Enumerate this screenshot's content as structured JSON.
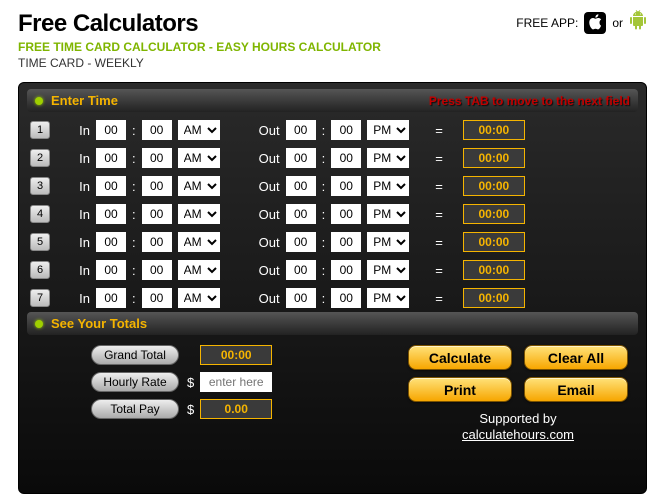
{
  "header": {
    "logo": "Free Calculators",
    "subtitle": "FREE TIME CARD CALCULATOR - EASY HOURS CALCULATOR",
    "breadcrumb": "TIME CARD - WEEKLY",
    "free_app": "FREE APP:",
    "or": "or"
  },
  "section_enter": "Enter Time",
  "hint": "Press TAB to move to the next field",
  "labels": {
    "in": "In",
    "out": "Out",
    "eq": "="
  },
  "days": [
    {
      "n": "1",
      "in_h": "00",
      "in_m": "00",
      "in_ap": "AM",
      "out_h": "00",
      "out_m": "00",
      "out_ap": "PM",
      "res": "00:00"
    },
    {
      "n": "2",
      "in_h": "00",
      "in_m": "00",
      "in_ap": "AM",
      "out_h": "00",
      "out_m": "00",
      "out_ap": "PM",
      "res": "00:00"
    },
    {
      "n": "3",
      "in_h": "00",
      "in_m": "00",
      "in_ap": "AM",
      "out_h": "00",
      "out_m": "00",
      "out_ap": "PM",
      "res": "00:00"
    },
    {
      "n": "4",
      "in_h": "00",
      "in_m": "00",
      "in_ap": "AM",
      "out_h": "00",
      "out_m": "00",
      "out_ap": "PM",
      "res": "00:00"
    },
    {
      "n": "5",
      "in_h": "00",
      "in_m": "00",
      "in_ap": "AM",
      "out_h": "00",
      "out_m": "00",
      "out_ap": "PM",
      "res": "00:00"
    },
    {
      "n": "6",
      "in_h": "00",
      "in_m": "00",
      "in_ap": "AM",
      "out_h": "00",
      "out_m": "00",
      "out_ap": "PM",
      "res": "00:00"
    },
    {
      "n": "7",
      "in_h": "00",
      "in_m": "00",
      "in_ap": "AM",
      "out_h": "00",
      "out_m": "00",
      "out_ap": "PM",
      "res": "00:00"
    }
  ],
  "section_totals": "See Your Totals",
  "totals": {
    "grand_total_label": "Grand Total",
    "grand_total": "00:00",
    "hourly_rate_label": "Hourly Rate",
    "hourly_rate_placeholder": "enter here",
    "total_pay_label": "Total Pay",
    "total_pay": "0.00",
    "dollar": "$"
  },
  "buttons": {
    "calculate": "Calculate",
    "clear_all": "Clear All",
    "print": "Print",
    "email": "Email"
  },
  "support": {
    "line1": "Supported by",
    "line2": "calculatehours.com"
  },
  "ampm_options": [
    "AM",
    "PM"
  ]
}
